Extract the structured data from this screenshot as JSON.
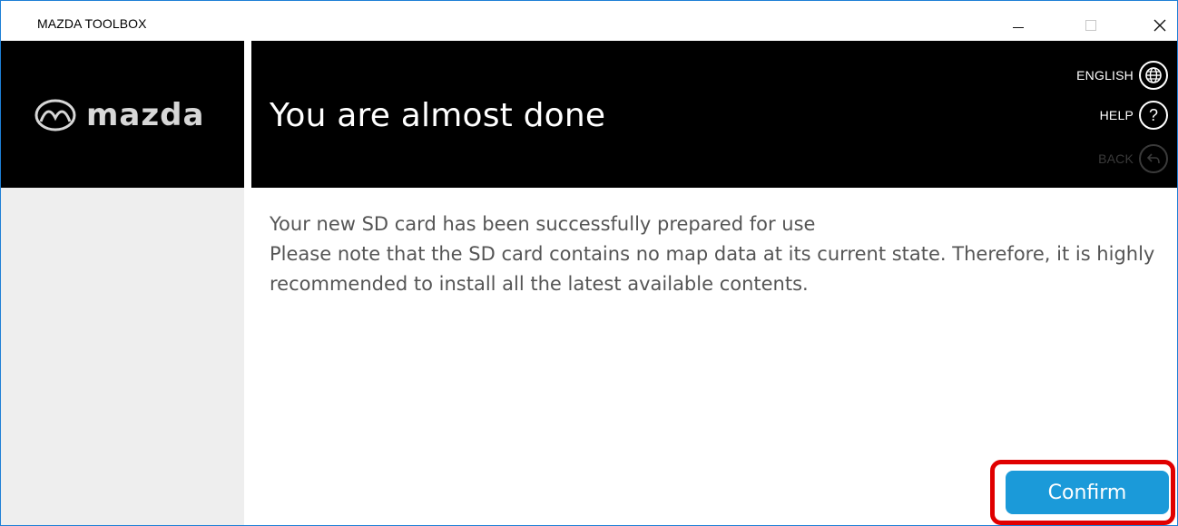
{
  "window": {
    "title": "MAZDA TOOLBOX"
  },
  "header": {
    "logo_text": "mazda",
    "title": "You are almost done",
    "language_label": "ENGLISH",
    "help_label": "HELP",
    "help_glyph": "?",
    "back_label": "BACK"
  },
  "content": {
    "line1": "Your new SD card has been successfully prepared for use",
    "line2": "Please note that the SD card contains no map data at its current state. Therefore, it is highly recommended to install all the latest available contents."
  },
  "actions": {
    "confirm_label": "Confirm"
  },
  "colors": {
    "header_bg": "#000000",
    "sidebar_bg": "#eeeeee",
    "confirm_bg": "#1b9ad9",
    "highlight": "#e00000",
    "window_border": "#1e7fd6"
  },
  "icons": {
    "language": "globe-icon",
    "help": "question-icon",
    "back": "back-arrow-icon",
    "logo": "mazda-logo-icon"
  }
}
